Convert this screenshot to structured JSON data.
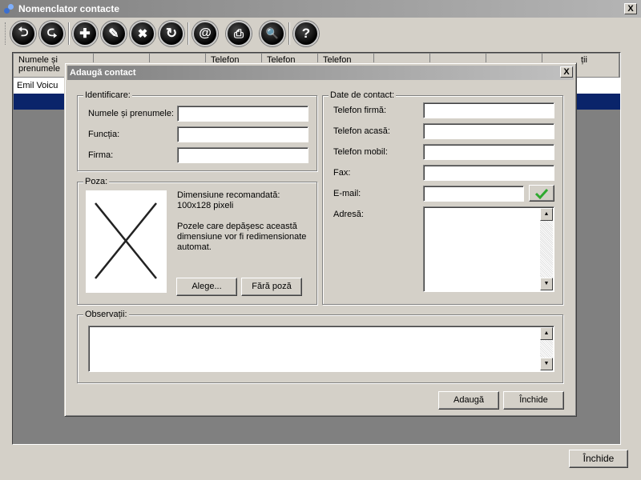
{
  "window": {
    "title": "Nomenclator contacte",
    "close_glyph": "X",
    "close_button_label": "Închide"
  },
  "toolbar": {
    "buttons": [
      {
        "name": "back-icon",
        "glyph": "⮌"
      },
      {
        "name": "forward-icon",
        "glyph": "⮎"
      },
      {
        "name": "add-icon",
        "glyph": "✚"
      },
      {
        "name": "edit-icon",
        "glyph": "✎"
      },
      {
        "name": "delete-icon",
        "glyph": "✖"
      },
      {
        "name": "refresh-icon",
        "glyph": "↻"
      },
      {
        "name": "email-icon",
        "glyph": "@"
      },
      {
        "name": "print-icon",
        "glyph": "⎙"
      },
      {
        "name": "search-icon",
        "glyph": "🔍"
      },
      {
        "name": "help-icon",
        "glyph": "?"
      }
    ]
  },
  "grid": {
    "columns": [
      "Numele și prenumele",
      "",
      "",
      "Telefon",
      "Telefon",
      "Telefon",
      "",
      "",
      "",
      "ții"
    ],
    "rows": [
      {
        "name": "Emil Voicu"
      }
    ]
  },
  "dialog": {
    "title": "Adaugă contact",
    "close_glyph": "X",
    "identificare": {
      "legend": "Identificare:",
      "name_label": "Numele și prenumele:",
      "name_value": "",
      "function_label": "Funcția:",
      "function_value": "",
      "company_label": "Firma:",
      "company_value": ""
    },
    "poza": {
      "legend": "Poza:",
      "info_line1": "Dimensiune recomandată:",
      "info_line2": "100x128 pixeli",
      "info_line3": "Pozele care depășesc această",
      "info_line4": "dimensiune vor fi redimensionate",
      "info_line5": "automat.",
      "choose_button": "Alege...",
      "no_photo_button": "Fără poză"
    },
    "contact": {
      "legend": "Date de contact:",
      "phone_company_label": "Telefon firmă:",
      "phone_home_label": "Telefon acasă:",
      "phone_mobile_label": "Telefon mobil:",
      "fax_label": "Fax:",
      "email_label": "E-mail:",
      "address_label": "Adresă:"
    },
    "observatii": {
      "legend": "Observații:"
    },
    "add_button": "Adaugă",
    "close_button": "Închide"
  }
}
